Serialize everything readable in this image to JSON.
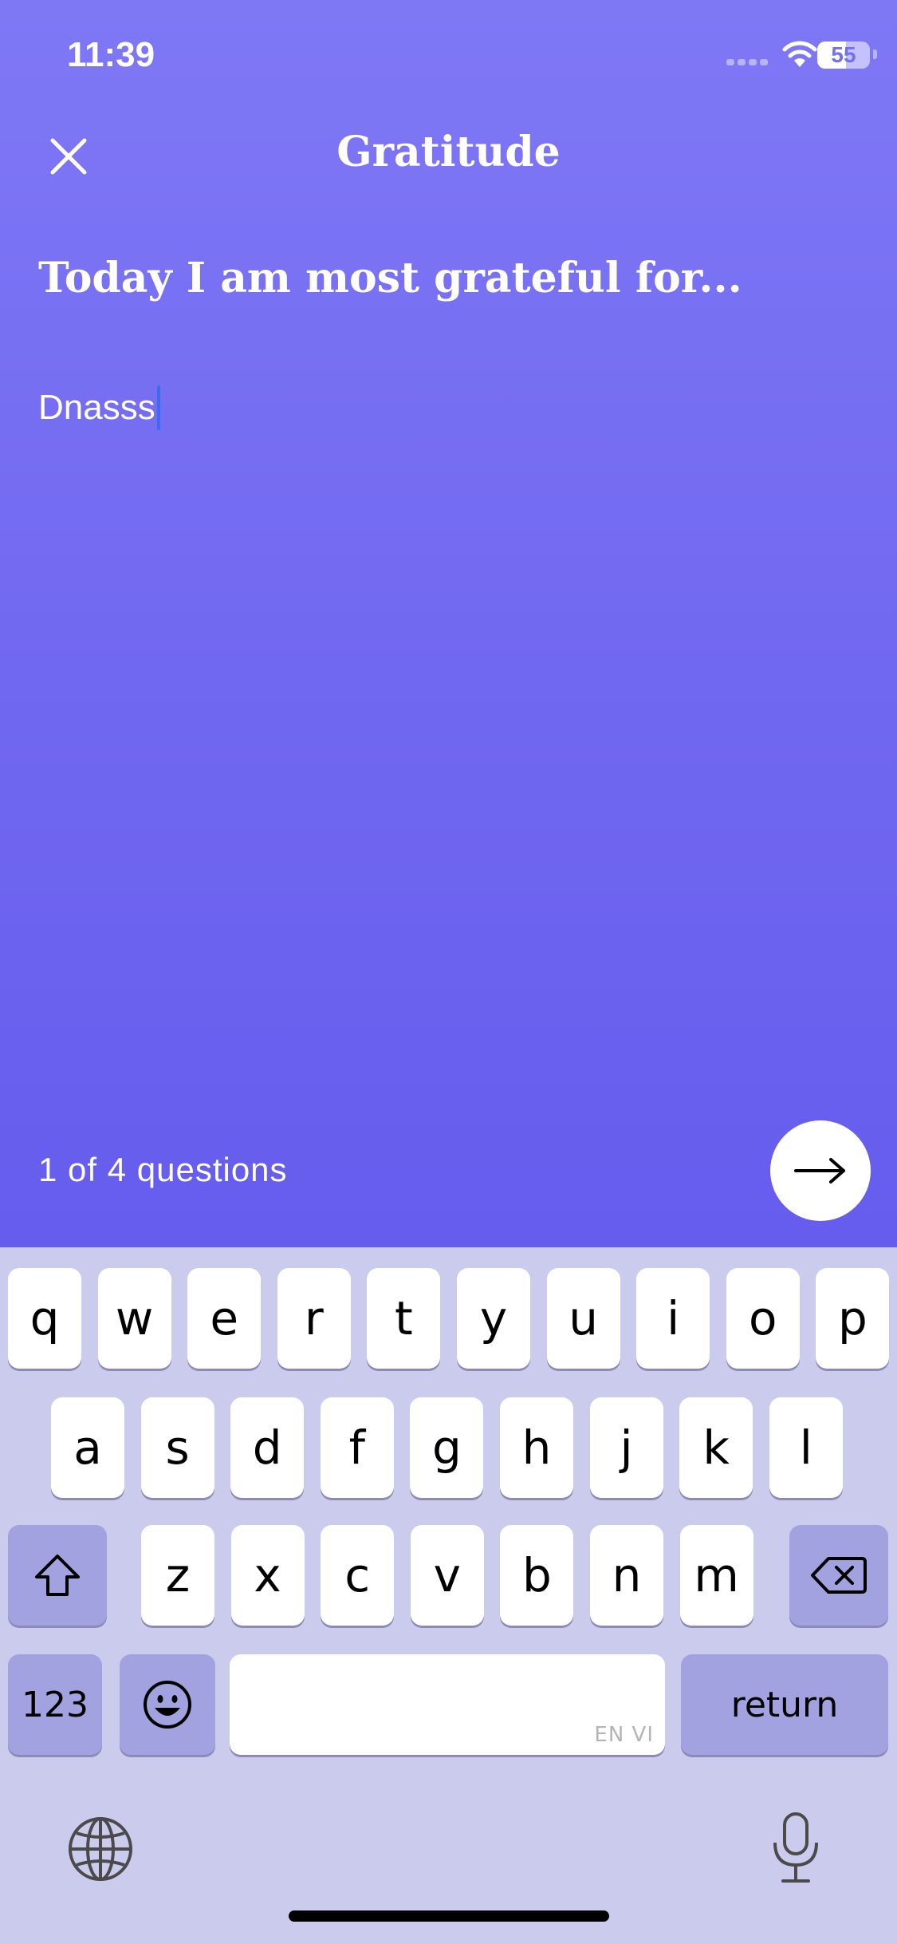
{
  "status_bar": {
    "time": "11:39",
    "battery_level": "55"
  },
  "header": {
    "title": "Gratitude"
  },
  "prompt": {
    "question": "Today I am most grateful for...",
    "answer_value": "Dnasss"
  },
  "footer": {
    "progress": "1 of 4 questions"
  },
  "keyboard": {
    "row1": [
      "q",
      "w",
      "e",
      "r",
      "t",
      "y",
      "u",
      "i",
      "o",
      "p"
    ],
    "row2": [
      "a",
      "s",
      "d",
      "f",
      "g",
      "h",
      "j",
      "k",
      "l"
    ],
    "row3": [
      "z",
      "x",
      "c",
      "v",
      "b",
      "n",
      "m"
    ],
    "numbers_label": "123",
    "return_label": "return",
    "space_hint": "EN VI"
  },
  "icons": {
    "close": "close-icon",
    "next": "arrow-right-icon",
    "shift": "shift-icon",
    "backspace": "backspace-icon",
    "emoji": "emoji-icon",
    "globe": "globe-icon",
    "mic": "microphone-icon"
  },
  "colors": {
    "gradient_top": "#7f78f5",
    "gradient_bottom": "#665cee",
    "caret": "#3b6cf0",
    "keyboard_bg": "#cbcbee"
  }
}
